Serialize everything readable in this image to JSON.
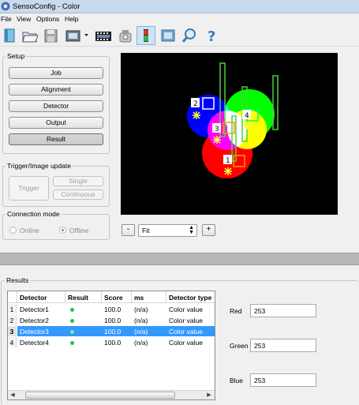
{
  "window": {
    "title": "SensoConfig - Color"
  },
  "menu": {
    "items": [
      "File",
      "View",
      "Options",
      "Help"
    ]
  },
  "toolbar": {
    "buttons": [
      "new-icon",
      "open-icon",
      "save-icon",
      "device-icon",
      "filmstrip-icon",
      "camera-icon",
      "sensor-mode-icon",
      "image-view-icon",
      "magnifier-icon",
      "help-icon"
    ],
    "active": "sensor-mode-icon"
  },
  "setup": {
    "title": "Setup",
    "buttons": [
      "Job",
      "Alignment",
      "Detector",
      "Output",
      "Result"
    ],
    "pressed": "Result"
  },
  "trigger": {
    "title": "Trigger/Image update",
    "trigger_label": "Trigger",
    "single_label": "Single",
    "continuous_label": "Continuous"
  },
  "connection": {
    "title": "Connection mode",
    "online_label": "Online",
    "offline_label": "Offline",
    "selected": "Offline"
  },
  "viewer": {
    "markers": [
      "1",
      "2",
      "3",
      "4"
    ],
    "zoom_out": "-",
    "zoom_value": "Fit",
    "zoom_in": "+"
  },
  "results": {
    "title": "Results",
    "columns": [
      "Detector",
      "Result",
      "Score",
      "ms",
      "Detector type"
    ],
    "rows": [
      {
        "num": "1",
        "detector": "Detector1",
        "score": "100.0",
        "ms": "(n/a)",
        "type": "Color value"
      },
      {
        "num": "2",
        "detector": "Detector2",
        "score": "100.0",
        "ms": "(n/a)",
        "type": "Color value"
      },
      {
        "num": "3",
        "detector": "Detector3",
        "score": "100.0",
        "ms": "(n/a)",
        "type": "Color value"
      },
      {
        "num": "4",
        "detector": "Detector4",
        "score": "100.0",
        "ms": "(n/a)",
        "type": "Color value"
      }
    ],
    "selected_row": 2,
    "red_label": "Red",
    "red_value": "253",
    "green_label": "Green",
    "green_value": "253",
    "blue_label": "Blue",
    "blue_value": "253"
  },
  "colors": {
    "selection": "#3399ff",
    "ok_dot": "#22c43d",
    "viewer_bg": "#000000"
  }
}
